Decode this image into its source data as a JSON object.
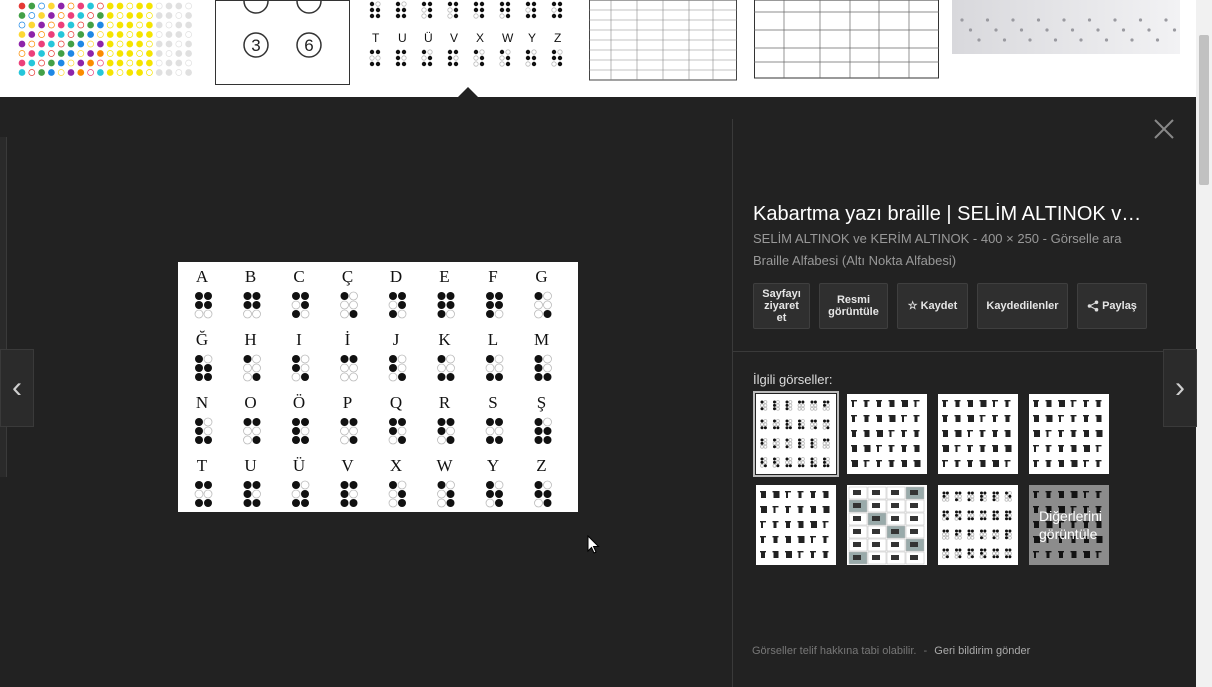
{
  "viewer": {
    "title": "Kabartma yazı braille | SELİM ALTINOK ve KERİM ALTINOK",
    "source": "SELİM ALTINOK ve KERİM ALTINOK",
    "size": "400 × 250",
    "search_link": "Görselle ara",
    "caption": "Braille Alfabesi (Altı Nokta Alfabesi)",
    "sep": "-"
  },
  "buttons": {
    "visit": "Sayfayı ziyaret et",
    "view": "Resmi görüntüle",
    "save": "Kaydet",
    "saved": "Kaydedilenler",
    "share": "Paylaş"
  },
  "related": {
    "label": "İlgili görseller:",
    "more_line1": "Diğerlerini",
    "more_line2": "görüntüle"
  },
  "footer": {
    "notice": "Görseller telif hakkına tabi olabilir.",
    "feedback": "Geri bildirim gönder",
    "sep": "-"
  },
  "strip": {
    "dot_labels": [
      "3",
      "6"
    ],
    "alphabet_row": [
      "T",
      "U",
      "Ü",
      "V",
      "X",
      "W",
      "Y",
      "Z"
    ]
  },
  "braille_chart": {
    "rows": [
      [
        "A",
        "B",
        "C",
        "Ç",
        "D",
        "E",
        "F",
        "G"
      ],
      [
        "Ğ",
        "H",
        "I",
        "İ",
        "J",
        "K",
        "L",
        "M"
      ],
      [
        "N",
        "O",
        "Ö",
        "P",
        "Q",
        "R",
        "S",
        "Ş"
      ],
      [
        "T",
        "U",
        "Ü",
        "V",
        "X",
        "W",
        "Y",
        "Z"
      ]
    ]
  },
  "nav": {
    "prev": "‹",
    "next": "›"
  },
  "colors": {
    "panel": "#222222",
    "accent": "#ffffff"
  }
}
